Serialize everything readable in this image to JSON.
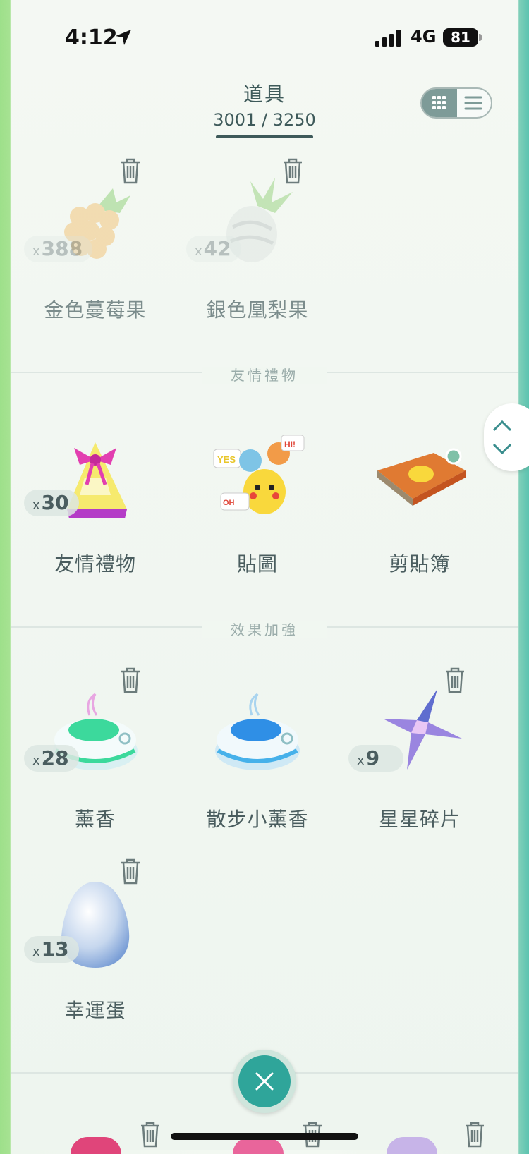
{
  "status_bar": {
    "time": "4:12",
    "network": "4G",
    "battery": "81"
  },
  "header": {
    "title": "道具",
    "count": "3001 / 3250"
  },
  "sections": [
    {
      "label": "友情禮物"
    },
    {
      "label": "效果加強"
    }
  ],
  "items": {
    "golden_razz": {
      "name": "金色蔓莓果",
      "qty": "388"
    },
    "silver_pinap": {
      "name": "銀色凰梨果",
      "qty": "42"
    },
    "gift": {
      "name": "友情禮物",
      "qty": "30"
    },
    "stickers": {
      "name": "貼圖"
    },
    "scrapbook": {
      "name": "剪貼簿"
    },
    "incense": {
      "name": "薰香",
      "qty": "28"
    },
    "daily_incense": {
      "name": "散步小薰香"
    },
    "star_piece": {
      "name": "星星碎片",
      "qty": "9"
    },
    "lucky_egg": {
      "name": "幸運蛋",
      "qty": "13"
    }
  },
  "qty_prefix": "x",
  "colors": {
    "accent": "#2fa59a",
    "text": "#4a5d5f",
    "bg": "#f3f8f2"
  }
}
